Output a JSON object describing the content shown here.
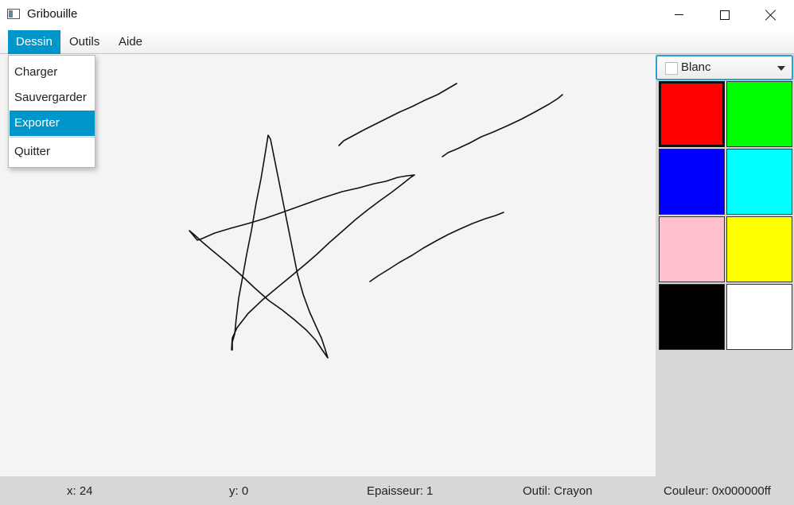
{
  "window": {
    "title": "Gribouille"
  },
  "menubar": {
    "items": [
      {
        "label": "Dessin"
      },
      {
        "label": "Outils"
      },
      {
        "label": "Aide"
      }
    ]
  },
  "dropdown": {
    "items": [
      {
        "label": "Charger"
      },
      {
        "label": "Sauvergarder"
      },
      {
        "label": "Exporter"
      },
      {
        "label": "Quitter"
      }
    ],
    "selected": "Exporter"
  },
  "palette": {
    "selected_label": "Blanc",
    "colors": [
      {
        "name": "red",
        "hex": "#ff0000",
        "selected": true
      },
      {
        "name": "green",
        "hex": "#00ff00"
      },
      {
        "name": "blue",
        "hex": "#0000ff"
      },
      {
        "name": "cyan",
        "hex": "#00ffff"
      },
      {
        "name": "pink",
        "hex": "#ffc0cb"
      },
      {
        "name": "yellow",
        "hex": "#ffff00"
      },
      {
        "name": "black",
        "hex": "#000000"
      },
      {
        "name": "white",
        "hex": "#ffffff"
      }
    ]
  },
  "statusbar": {
    "x": "x: 24",
    "y": "y: 0",
    "epaisseur": "Epaisseur: 1",
    "outil": "Outil: Crayon",
    "couleur": "Couleur: 0x000000ff"
  }
}
